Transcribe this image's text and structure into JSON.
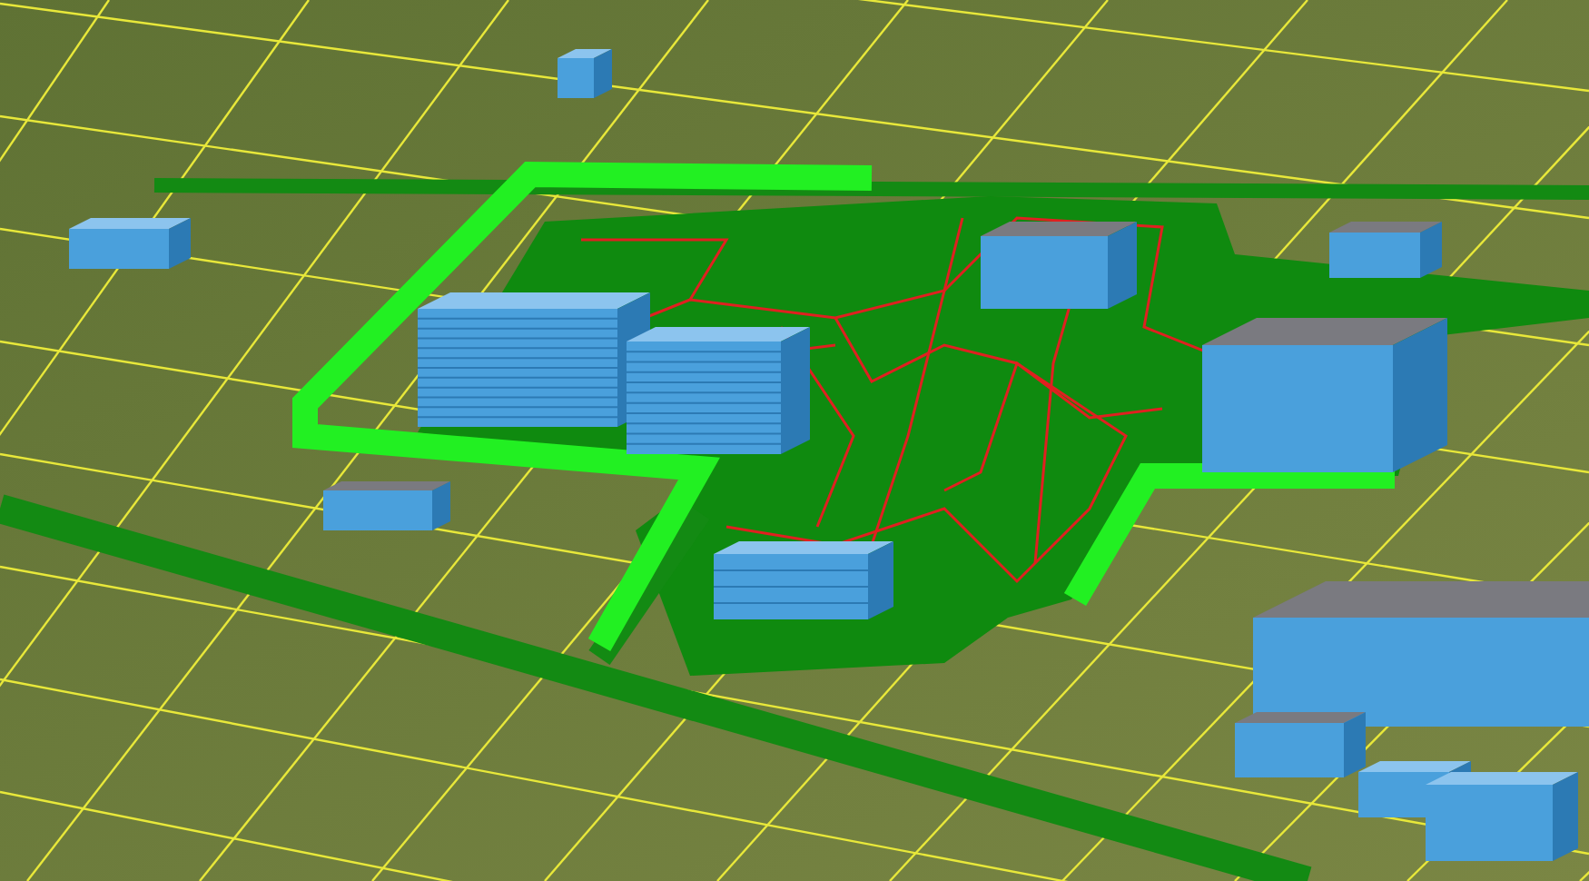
{
  "view": {
    "kind": "site-plan"
  }
}
